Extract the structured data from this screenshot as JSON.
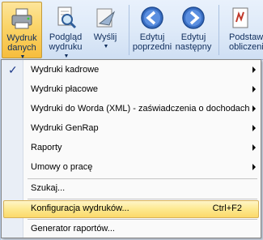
{
  "ribbon": {
    "buttons": [
      {
        "line1": "Wydruk",
        "line2": "danych",
        "dropdown": true
      },
      {
        "line1": "Podgląd",
        "line2": "wydruku",
        "dropdown": true
      },
      {
        "line1": "Wyślij",
        "line2": "",
        "dropdown": true
      },
      {
        "line1": "Edytuj",
        "line2": "poprzedni"
      },
      {
        "line1": "Edytuj",
        "line2": "następny"
      },
      {
        "line1": "Podstawy",
        "line2": "obliczeniow"
      }
    ]
  },
  "menu": {
    "items": [
      {
        "label": "Wydruki kadrowe",
        "checked": true,
        "submenu": true
      },
      {
        "label": "Wydruki płacowe",
        "submenu": true
      },
      {
        "label": "Wydruki do Worda (XML) - zaświadczenia o dochodach",
        "submenu": true
      },
      {
        "label": "Wydruki GenRap",
        "submenu": true
      },
      {
        "label": "Raporty",
        "submenu": true
      },
      {
        "label": "Umowy o pracę",
        "submenu": true
      },
      {
        "label": "Szukaj..."
      },
      {
        "label": "Konfiguracja wydruków...",
        "shortcut": "Ctrl+F2",
        "highlighted": true
      },
      {
        "label": "Generator raportów..."
      }
    ]
  },
  "colors": {
    "highlight": "#fbd96a",
    "active_button": "#f6bd3d",
    "ribbon": "#dde9f8"
  }
}
